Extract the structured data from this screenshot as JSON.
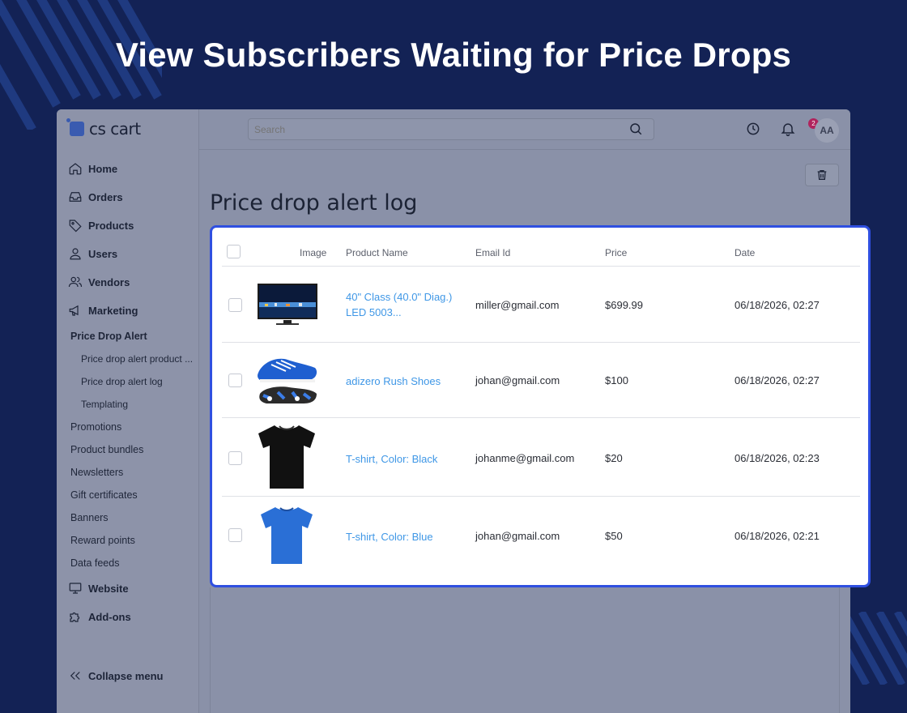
{
  "hero": {
    "title": "View Subscribers Waiting for Price Drops"
  },
  "brand": {
    "logo_text": "cs cart"
  },
  "search": {
    "placeholder": "Search"
  },
  "notifications": {
    "count": "2"
  },
  "user": {
    "initials": "AA"
  },
  "sidebar": {
    "items": [
      {
        "label": "Home",
        "icon": "home-icon"
      },
      {
        "label": "Orders",
        "icon": "inbox-icon"
      },
      {
        "label": "Products",
        "icon": "tag-icon"
      },
      {
        "label": "Users",
        "icon": "user-icon"
      },
      {
        "label": "Vendors",
        "icon": "users-icon"
      },
      {
        "label": "Marketing",
        "icon": "megaphone-icon"
      }
    ],
    "marketing_sub": {
      "section": "Price Drop Alert",
      "deep": [
        "Price drop alert product ...",
        "Price drop alert log",
        "Templating"
      ],
      "items": [
        "Promotions",
        "Product bundles",
        "Newsletters",
        "Gift certificates",
        "Banners",
        "Reward points",
        "Data feeds"
      ]
    },
    "bottom_items": [
      {
        "label": "Website",
        "icon": "monitor-icon"
      },
      {
        "label": "Add-ons",
        "icon": "puzzle-icon"
      }
    ],
    "collapse_label": "Collapse menu"
  },
  "page": {
    "title": "Price drop alert log"
  },
  "table": {
    "columns": [
      "Image",
      "Product Name",
      "Email Id",
      "Price",
      "Date"
    ],
    "rows": [
      {
        "image": "tv-image",
        "product_line1": "40\" Class (40.0\" Diag.)",
        "product_line2": "LED 5003...",
        "email": "miller@gmail.com",
        "price": "$699.99",
        "date": "06/18/2026, 02:27"
      },
      {
        "image": "shoes-image",
        "product_line1": "adizero Rush Shoes",
        "product_line2": "",
        "email": "johan@gmail.com",
        "price": "$100",
        "date": "06/18/2026, 02:27"
      },
      {
        "image": "black-tshirt-image",
        "product_line1": "T-shirt, Color: Black",
        "product_line2": "",
        "email": "johanme@gmail.com",
        "price": "$20",
        "date": "06/18/2026, 02:23"
      },
      {
        "image": "blue-tshirt-image",
        "product_line1": "T-shirt, Color: Blue",
        "product_line2": "",
        "email": "johan@gmail.com",
        "price": "$50",
        "date": "06/18/2026, 02:21"
      }
    ]
  },
  "colors": {
    "background": "#132255",
    "highlight_border": "#2f4fe0",
    "link": "#3f97e6",
    "badge": "#b0245d"
  }
}
